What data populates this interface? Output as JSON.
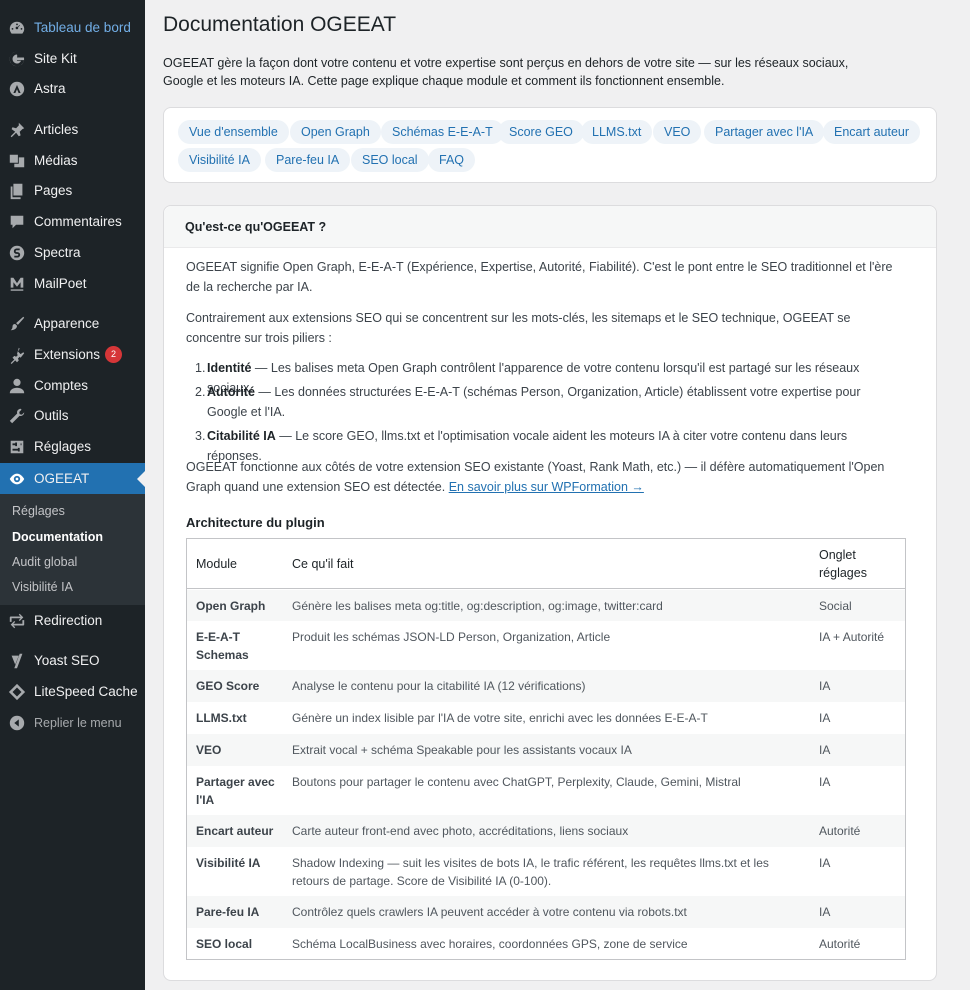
{
  "sidebar": {
    "items": [
      {
        "label": "Tableau de bord",
        "icon": "dashboard-icon"
      },
      {
        "label": "Site Kit",
        "icon": "google-g-icon"
      },
      {
        "label": "Astra",
        "icon": "astra-icon"
      },
      {
        "label": "Articles",
        "icon": "pushpin-icon"
      },
      {
        "label": "Médias",
        "icon": "media-icon"
      },
      {
        "label": "Pages",
        "icon": "pages-icon"
      },
      {
        "label": "Commentaires",
        "icon": "comment-icon"
      },
      {
        "label": "Spectra",
        "icon": "spectra-icon"
      },
      {
        "label": "MailPoet",
        "icon": "mailpoet-icon"
      },
      {
        "label": "Apparence",
        "icon": "paintbrush-icon"
      },
      {
        "label": "Extensions",
        "icon": "plugin-icon",
        "badge": "2"
      },
      {
        "label": "Comptes",
        "icon": "user-icon"
      },
      {
        "label": "Outils",
        "icon": "wrench-icon"
      },
      {
        "label": "Réglages",
        "icon": "settings-sliders-icon"
      },
      {
        "label": "OGEEAT",
        "icon": "ogeeat-icon"
      },
      {
        "label": "Redirection",
        "icon": "redirect-icon"
      },
      {
        "label": "Yoast SEO",
        "icon": "yoast-icon"
      },
      {
        "label": "LiteSpeed Cache",
        "icon": "diamond-icon"
      },
      {
        "label": "Replier le menu",
        "icon": "collapse-icon"
      }
    ],
    "submenu": [
      "Réglages",
      "Documentation",
      "Audit global",
      "Visibilité IA"
    ]
  },
  "page": {
    "title": "Documentation OGEEAT",
    "intro": "OGEEAT gère la façon dont votre contenu et votre expertise sont perçus en dehors de votre site — sur les réseaux sociaux, Google et les moteurs IA. Cette page explique chaque module et comment ils fonctionnent ensemble."
  },
  "nav": [
    "Vue d'ensemble",
    "Open Graph",
    "Schémas E-E-A-T",
    "Score GEO",
    "LLMS.txt",
    "VEO",
    "Partager avec l'IA",
    "Encart auteur",
    "Visibilité IA",
    "Pare-feu IA",
    "SEO local",
    "FAQ"
  ],
  "section": {
    "title": "Qu'est-ce qu'OGEEAT ?",
    "p1": "OGEEAT signifie Open Graph, E-E-A-T (Expérience, Expertise, Autorité, Fiabilité). C'est le pont entre le SEO traditionnel et l'ère de la recherche par IA.",
    "p2": "Contrairement aux extensions SEO qui se concentrent sur les mots-clés, les sitemaps et le SEO technique, OGEEAT se concentre sur trois piliers :",
    "pillars": [
      {
        "num": "1.",
        "name": "Identité",
        "text": " — Les balises meta Open Graph contrôlent l'apparence de votre contenu lorsqu'il est partagé sur les réseaux sociaux."
      },
      {
        "num": "2.",
        "name": "Autorité",
        "text": " — Les données structurées E-E-A-T (schémas Person, Organization, Article) établissent votre expertise pour Google et l'IA."
      },
      {
        "num": "3.",
        "name": "Citabilité IA",
        "text": " — Le score GEO, llms.txt et l'optimisation vocale aident les moteurs IA à citer votre contenu dans leurs réponses."
      }
    ],
    "p3": "OGEEAT fonctionne aux côtés de votre extension SEO existante (Yoast, Rank Math, etc.) — il défère automatiquement l'Open Graph quand une extension SEO est détectée. ",
    "link": "En savoir plus sur WPFormation →"
  },
  "architecture": {
    "title": "Architecture du plugin",
    "headers": [
      "Module",
      "Ce qu'il fait",
      "Onglet réglages"
    ],
    "rows": [
      {
        "module": "Open Graph",
        "desc": "Génère les balises meta og:title, og:description, og:image, twitter:card",
        "tab": "Social"
      },
      {
        "module": "E-E-A-T Schemas",
        "desc": "Produit les schémas JSON-LD Person, Organization, Article",
        "tab": "IA + Autorité"
      },
      {
        "module": "GEO Score",
        "desc": "Analyse le contenu pour la citabilité IA (12 vérifications)",
        "tab": "IA"
      },
      {
        "module": "LLMS.txt",
        "desc": "Génère un index lisible par l'IA de votre site, enrichi avec les données E-E-A-T",
        "tab": "IA"
      },
      {
        "module": "VEO",
        "desc": "Extrait vocal + schéma Speakable pour les assistants vocaux IA",
        "tab": "IA"
      },
      {
        "module": "Partager avec l'IA",
        "desc": "Boutons pour partager le contenu avec ChatGPT, Perplexity, Claude, Gemini, Mistral",
        "tab": "IA"
      },
      {
        "module": "Encart auteur",
        "desc": "Carte auteur front-end avec photo, accréditations, liens sociaux",
        "tab": "Autorité"
      },
      {
        "module": "Visibilité IA",
        "desc": "Shadow Indexing — suit les visites de bots IA, le trafic référent, les requêtes llms.txt et les retours de partage. Score de Visibilité IA (0-100).",
        "tab": "IA"
      },
      {
        "module": "Pare-feu IA",
        "desc": "Contrôlez quels crawlers IA peuvent accéder à votre contenu via robots.txt",
        "tab": "IA"
      },
      {
        "module": "SEO local",
        "desc": "Schéma LocalBusiness avec horaires, coordonnées GPS, zone de service",
        "tab": "Autorité"
      }
    ]
  }
}
